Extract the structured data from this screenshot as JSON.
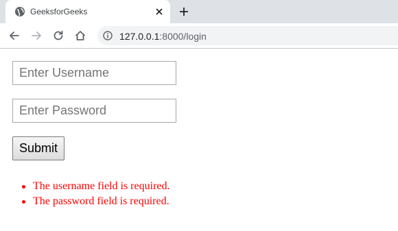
{
  "tab": {
    "title": "GeeksforGeeks",
    "favicon": "globe-icon"
  },
  "toolbar": {
    "back": "back-arrow-icon",
    "forward": "forward-arrow-icon",
    "reload": "reload-icon",
    "home": "home-icon",
    "url_host": "127.0.0.1",
    "url_path": ":8000/login"
  },
  "form": {
    "username_placeholder": "Enter Username",
    "password_placeholder": "Enter Password",
    "submit_label": "Submit"
  },
  "errors": [
    "The username field is required.",
    "The password field is required."
  ],
  "colors": {
    "error": "#ff0000",
    "tabstrip": "#dee1e6",
    "omnibox": "#f1f3f4"
  }
}
